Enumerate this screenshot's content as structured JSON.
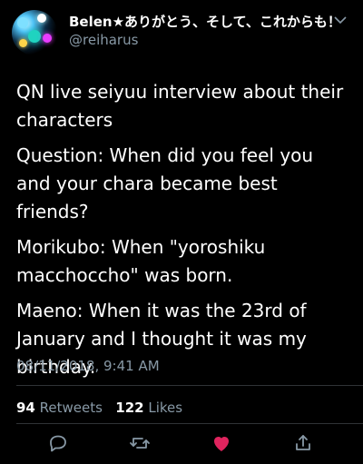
{
  "tweet": {
    "author_name": "Belen★ありがとう、そして、これからも！",
    "author_handle": "@reiharus",
    "paragraphs": [
      "QN live seiyuu interview about their characters",
      "Question: When did you feel you and your chara became best friends?",
      "Morikubo: When \"yoroshiku macchoccho\" was born.",
      "Maeno: When it was the 23rd of January and I thought it was my birthday."
    ],
    "timestamp": "08/11/2018, 9:41 AM",
    "retweets_count": "94",
    "retweets_label": "Retweets",
    "likes_count": "122",
    "likes_label": "Likes"
  },
  "colors": {
    "background": "#000000",
    "text": "#ffffff",
    "muted": "#8899a6",
    "divider": "#2f3336",
    "like_red": "#e0245e"
  },
  "icons": {
    "reply": "reply-icon",
    "retweet": "retweet-icon",
    "like": "heart-icon",
    "share": "share-icon",
    "more": "chevron-down-icon"
  }
}
